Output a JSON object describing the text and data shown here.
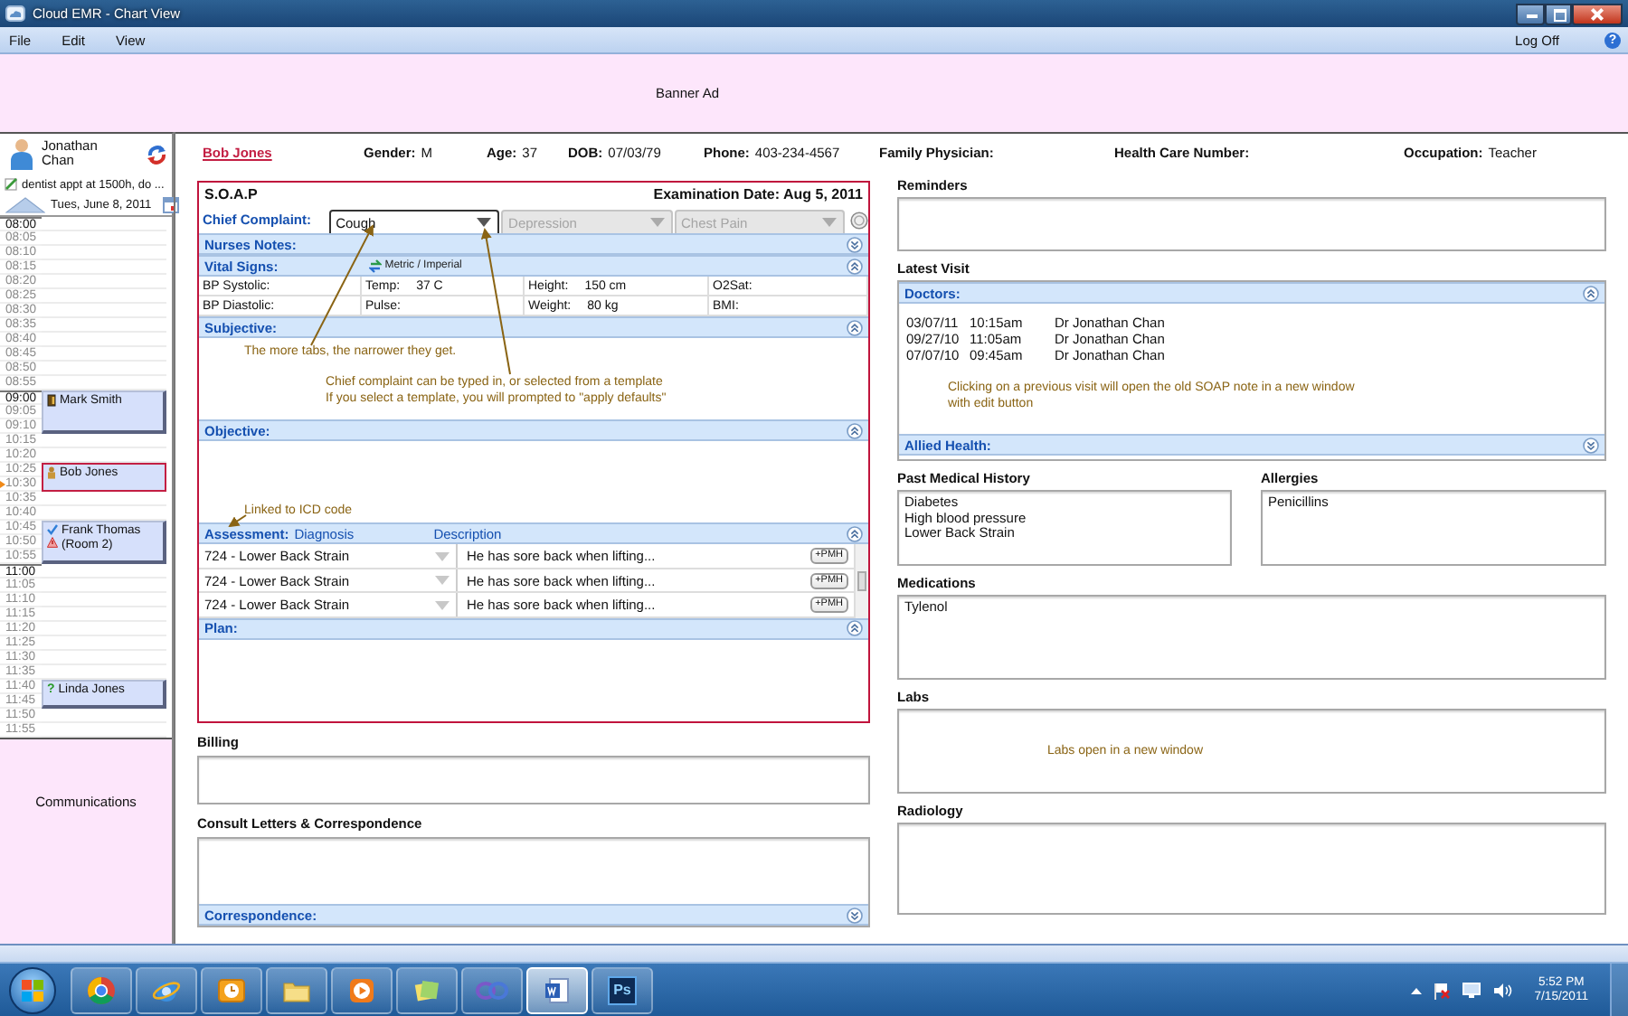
{
  "window": {
    "title": "Cloud EMR - Chart View"
  },
  "menu": {
    "items": [
      "File",
      "Edit",
      "View"
    ],
    "log_off": "Log Off",
    "help": "?"
  },
  "banner": {
    "text": "Banner Ad"
  },
  "sidebar": {
    "user": "Jonathan Chan",
    "note": "dentist appt at 1500h, do ...",
    "date": "Tues, June 8, 2011",
    "communications": "Communications",
    "slots": [
      {
        "time": "08:00",
        "major": true
      },
      {
        "time": "08:05",
        "major": false
      },
      {
        "time": "08:10",
        "major": false
      },
      {
        "time": "08:15",
        "major": false
      },
      {
        "time": "08:20",
        "major": false
      },
      {
        "time": "08:25",
        "major": false
      },
      {
        "time": "08:30",
        "major": false
      },
      {
        "time": "08:35",
        "major": false
      },
      {
        "time": "08:40",
        "major": false
      },
      {
        "time": "08:45",
        "major": false
      },
      {
        "time": "08:50",
        "major": false
      },
      {
        "time": "08:55",
        "major": false
      },
      {
        "time": "09:00",
        "major": true,
        "booked": true,
        "appointment": {
          "name": "Mark Smith",
          "kind": "door",
          "selected": false
        }
      },
      {
        "time": "09:05",
        "major": false,
        "booked": true
      },
      {
        "time": "09:10",
        "major": false,
        "booked": true
      },
      {
        "time": "10:15",
        "major": false
      },
      {
        "time": "10:20",
        "major": false
      },
      {
        "time": "10:25",
        "major": false,
        "booked": true,
        "appointment": {
          "name": "Bob Jones",
          "kind": "person",
          "selected": true
        }
      },
      {
        "time": "10:30",
        "major": false,
        "booked": true,
        "current": true
      },
      {
        "time": "10:35",
        "major": false
      },
      {
        "time": "10:40",
        "major": false
      },
      {
        "time": "10:45",
        "major": false,
        "booked": true,
        "appointment": {
          "name": "Frank Thomas (Room 2)",
          "kind": "checked-alert",
          "selected": false
        }
      },
      {
        "time": "10:50",
        "major": false,
        "booked": true
      },
      {
        "time": "10:55",
        "major": false,
        "booked": true
      },
      {
        "time": "11:00",
        "major": true
      },
      {
        "time": "11:05",
        "major": false
      },
      {
        "time": "11:10",
        "major": false
      },
      {
        "time": "11:15",
        "major": false
      },
      {
        "time": "11:20",
        "major": false
      },
      {
        "time": "11:25",
        "major": false
      },
      {
        "time": "11:30",
        "major": false
      },
      {
        "time": "11:35",
        "major": false
      },
      {
        "time": "11:40",
        "major": false,
        "booked": true,
        "appointment": {
          "name": "Linda Jones",
          "kind": "unknown",
          "mark": "?",
          "selected": false
        }
      },
      {
        "time": "11:45",
        "major": false,
        "booked": true
      },
      {
        "time": "11:50",
        "major": false
      },
      {
        "time": "11:55",
        "major": false
      }
    ]
  },
  "patient": {
    "name": "Bob Jones",
    "fields": [
      {
        "label": "Gender:",
        "value": "M"
      },
      {
        "label": "Age:",
        "value": "37"
      },
      {
        "label": "DOB:",
        "value": "07/03/79"
      },
      {
        "label": "Phone:",
        "value": "403-234-4567"
      },
      {
        "label": "Family Physician:"
      },
      {
        "label": "Health Care Number:"
      },
      {
        "label": "Occupation:",
        "value": "Teacher"
      }
    ]
  },
  "soap": {
    "title": "S.O.A.P",
    "exam_date": "Examination Date: Aug 5, 2011",
    "chief_complaint": {
      "label": "Chief Complaint:",
      "tabs": [
        {
          "value": "Cough",
          "selected": true
        },
        {
          "value": "Depression",
          "selected": false
        },
        {
          "value": "Chest Pain",
          "selected": false
        }
      ]
    },
    "sections": [
      {
        "kind": "text",
        "title": "Nurses Notes:",
        "expanded": false
      },
      {
        "kind": "vitals",
        "title": "Vital Signs:",
        "expanded": true,
        "toggle": "Metric / Imperial",
        "rows": [
          [
            {
              "label": "BP Systolic:"
            },
            {
              "label": "Temp:",
              "value": "37 C"
            },
            {
              "label": "Height:",
              "value": "150 cm"
            },
            {
              "label": "O2Sat:"
            }
          ],
          [
            {
              "label": "BP Diastolic:"
            },
            {
              "label": "Pulse:"
            },
            {
              "label": "Weight:",
              "value": "80 kg"
            },
            {
              "label": "BMI:"
            }
          ]
        ]
      },
      {
        "kind": "text",
        "title": "Subjective:",
        "expanded": true,
        "annotations": [
          {
            "lines": [
              "The more tabs, the narrower they get."
            ]
          },
          {
            "lines": [
              "Chief complaint can be typed in, or selected from a template",
              "If you select a template, you will prompted to \"apply defaults\""
            ]
          }
        ]
      },
      {
        "kind": "text",
        "title": "Objective:",
        "expanded": true,
        "annotations": [
          {
            "lines": [
              "Linked to ICD code"
            ]
          }
        ]
      },
      {
        "kind": "assessment",
        "title": "Assessment:",
        "expanded": true,
        "columns": [
          "Diagnosis",
          "Description"
        ],
        "rows": [
          {
            "diagnosis": "724 - Lower Back Strain",
            "description": "He has sore back when lifting...",
            "action": "+PMH"
          },
          {
            "diagnosis": "724 - Lower Back Strain",
            "description": "He has sore back when lifting...",
            "action": "+PMH"
          },
          {
            "diagnosis": "724 - Lower Back Strain",
            "description": "He has sore back when lifting...",
            "action": "+PMH"
          }
        ]
      },
      {
        "kind": "text",
        "title": "Plan:",
        "expanded": true
      }
    ]
  },
  "billing": {
    "title": "Billing"
  },
  "correspondence": {
    "title": "Consult Letters & Correspondence",
    "section": {
      "title": "Correspondence:",
      "expanded": false
    }
  },
  "reminders": {
    "title": "Reminders"
  },
  "latest_visit": {
    "title": "Latest Visit",
    "sections": [
      {
        "title": "Doctors:",
        "expanded": true,
        "visits": [
          {
            "date": "03/07/11",
            "time": "10:15am",
            "doctor": "Dr Jonathan Chan"
          },
          {
            "date": "09/27/10",
            "time": "11:05am",
            "doctor": "Dr Jonathan Chan"
          },
          {
            "date": "07/07/10",
            "time": "09:45am",
            "doctor": "Dr Jonathan Chan"
          }
        ],
        "note": [
          "Clicking on a previous visit will open the old SOAP note in a new window",
          "with edit button"
        ]
      },
      {
        "title": "Allied Health:",
        "expanded": false
      }
    ]
  },
  "history": {
    "title": "Past Medical History",
    "items": [
      "Diabetes",
      "High blood pressure",
      "Lower Back Strain"
    ]
  },
  "allergies": {
    "title": "Allergies",
    "items": [
      "Penicillins"
    ]
  },
  "medications": {
    "title": "Medications",
    "items": [
      "Tylenol"
    ]
  },
  "labs": {
    "title": "Labs",
    "note": "Labs open in a new window"
  },
  "radiology": {
    "title": "Radiology"
  },
  "taskbar": {
    "apps": [
      {
        "kind": "chrome",
        "selected": false
      },
      {
        "kind": "ie",
        "selected": false
      },
      {
        "kind": "outlook",
        "selected": false
      },
      {
        "kind": "explorer",
        "selected": false
      },
      {
        "kind": "media",
        "selected": false
      },
      {
        "kind": "notes",
        "selected": false
      },
      {
        "kind": "loop",
        "selected": false
      },
      {
        "kind": "word",
        "selected": true
      },
      {
        "kind": "photoshop",
        "label": "Ps",
        "selected": false
      }
    ],
    "time": "5:52 PM",
    "date": "7/15/2011"
  }
}
